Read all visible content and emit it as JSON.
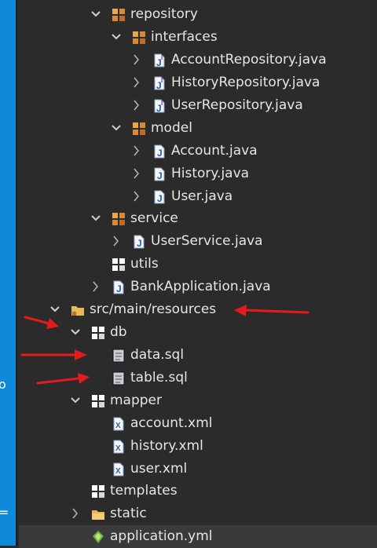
{
  "colors": {
    "background": "#2b2b2b",
    "text": "#e6e6e6",
    "left_strip": "#0e8ad8",
    "annotation_arrow": "#e31b1b"
  },
  "side": {
    "char1": "o",
    "char2": "="
  },
  "tree": [
    {
      "label": "repository",
      "icon": "package-icon",
      "chevron": "expanded"
    },
    {
      "label": "interfaces",
      "icon": "package-icon",
      "chevron": "expanded"
    },
    {
      "label": "AccountRepository.java",
      "icon": "java-interface-file-icon",
      "chevron": "collapsed"
    },
    {
      "label": "HistoryRepository.java",
      "icon": "java-interface-file-icon",
      "chevron": "collapsed"
    },
    {
      "label": "UserRepository.java",
      "icon": "java-interface-file-icon",
      "chevron": "collapsed"
    },
    {
      "label": "model",
      "icon": "package-icon",
      "chevron": "expanded"
    },
    {
      "label": "Account.java",
      "icon": "java-file-icon",
      "chevron": "collapsed"
    },
    {
      "label": "History.java",
      "icon": "java-file-icon",
      "chevron": "collapsed"
    },
    {
      "label": "User.java",
      "icon": "java-file-icon",
      "chevron": "collapsed"
    },
    {
      "label": "service",
      "icon": "package-icon",
      "chevron": "expanded"
    },
    {
      "label": "UserService.java",
      "icon": "java-file-icon",
      "chevron": "collapsed"
    },
    {
      "label": "utils",
      "icon": "empty-package-icon",
      "chevron": "none"
    },
    {
      "label": "BankApplication.java",
      "icon": "java-file-icon",
      "chevron": "collapsed"
    },
    {
      "label": "src/main/resources",
      "icon": "source-folder-icon",
      "chevron": "expanded"
    },
    {
      "label": "db",
      "icon": "empty-package-icon",
      "chevron": "expanded"
    },
    {
      "label": "data.sql",
      "icon": "sql-file-icon",
      "chevron": "none"
    },
    {
      "label": "table.sql",
      "icon": "sql-file-icon",
      "chevron": "none"
    },
    {
      "label": "mapper",
      "icon": "empty-package-icon",
      "chevron": "expanded"
    },
    {
      "label": "account.xml",
      "icon": "xml-file-icon",
      "chevron": "none"
    },
    {
      "label": "history.xml",
      "icon": "xml-file-icon",
      "chevron": "none"
    },
    {
      "label": "user.xml",
      "icon": "xml-file-icon",
      "chevron": "none"
    },
    {
      "label": "templates",
      "icon": "empty-package-icon",
      "chevron": "none"
    },
    {
      "label": "static",
      "icon": "folder-icon",
      "chevron": "collapsed"
    },
    {
      "label": "application.yml",
      "icon": "yaml-file-icon",
      "chevron": "none"
    }
  ]
}
